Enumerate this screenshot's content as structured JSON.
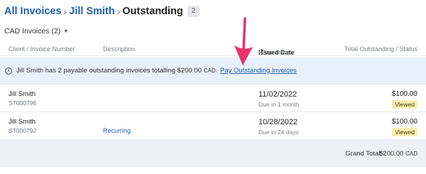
{
  "breadcrumb": {
    "root": "All Invoices",
    "client": "Jill Smith",
    "current": "Outstanding",
    "count": "2"
  },
  "filter": {
    "label": "CAD Invoices (2)"
  },
  "columns": {
    "client": "Client / Invoice Number",
    "description": "Description",
    "issued": "Issued Date",
    "due": "/ Due Date",
    "total": "Total Outstanding / Status"
  },
  "banner": {
    "text": "Jill Smith has 2 payable outstanding invoices totalling $200.00",
    "currency": "CAD.",
    "link": "Pay Outstanding Invoices"
  },
  "invoices": [
    {
      "client": "Jill Smith",
      "number": "ST000796",
      "description": "",
      "issued": "11/02/2022",
      "due": "Due in 1 month",
      "amount": "$100.00",
      "status": "Viewed"
    },
    {
      "client": "Jill Smith",
      "number": "ST000792",
      "description": "Recurring",
      "issued": "10/28/2022",
      "due": "Due in 24 days",
      "amount": "$100.00",
      "status": "Viewed"
    }
  ],
  "footer": {
    "label": "Grand Total:",
    "amount": "$200.00",
    "currency": "CAD"
  },
  "colors": {
    "link": "#1f5fb0",
    "banner_bg": "#e8f1fb",
    "status_bg": "#fbefb4",
    "arrow": "#e8336d"
  }
}
